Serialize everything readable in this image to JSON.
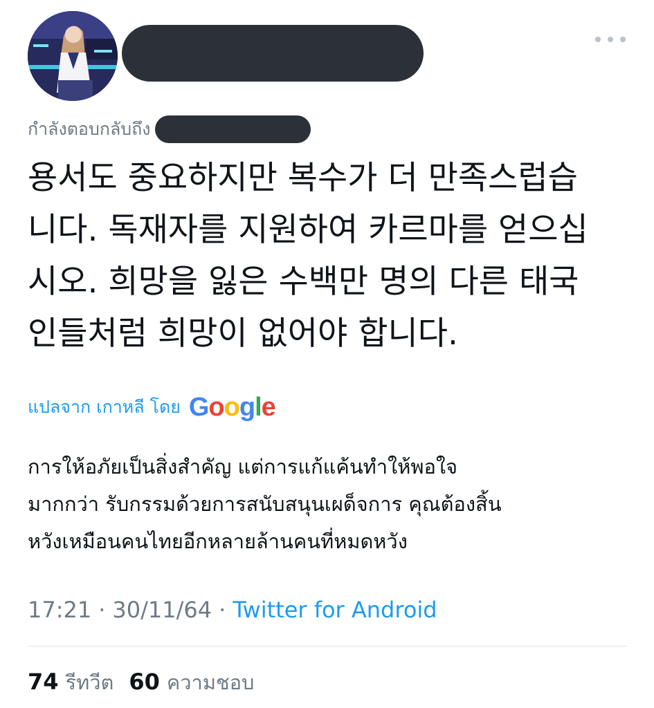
{
  "tweet": {
    "replying_to_label": "กำลังตอบกลับถึง",
    "text_lines": [
      "용서도 중요하지만 복수가 더 만족스럽습",
      "니다. 독재자를 지원하여 카르마를 얻으십",
      "시오. 희망을 잃은 수백만 명의 다른 태국",
      "인들처럼 희망이 없어야 합니다."
    ],
    "translate_label": "แปลจาก เกาหลี โดย",
    "google_logo": [
      "G",
      "o",
      "o",
      "g",
      "l",
      "e"
    ],
    "google_colors": [
      "#4285F4",
      "#EA4335",
      "#FBBC05",
      "#4285F4",
      "#34A853",
      "#EA4335"
    ],
    "translation_lines": [
      "การให้อภัยเป็นสิ่งสำคัญ แต่การแก้แค้นทำให้พอใจ",
      "มากกว่า รับกรรมด้วยการสนับสนุนเผด็จการ คุณต้องสิ้น",
      "หวังเหมือนคนไทยอีกหลายล้านคนที่หมดหวัง"
    ],
    "time": "17:21",
    "date": "30/11/64",
    "separator": "·",
    "source": "Twitter for Android",
    "retweets_count": "74",
    "retweets_label": "รีทวีต",
    "likes_count": "60",
    "likes_label": "ความชอบ"
  },
  "icons": {
    "more": "more-horizontal-icon",
    "avatar": "profile-avatar"
  },
  "colors": {
    "link": "#1d9bf0",
    "secondary_text": "#6e7a84",
    "primary_text": "#0f1419",
    "redaction": "#2b3137"
  }
}
